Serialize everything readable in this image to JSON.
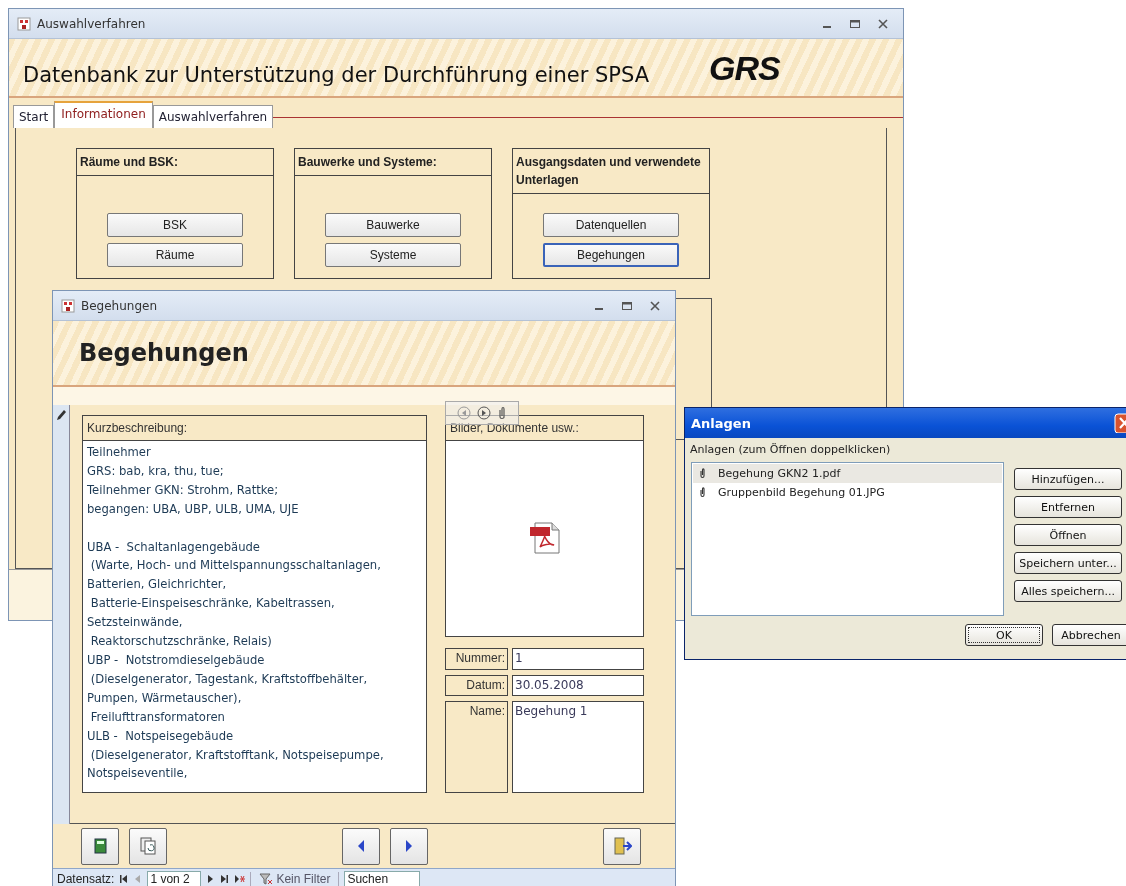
{
  "main_window": {
    "title": "Auswahlverfahren",
    "header_title": "Datenbank zur Unterstützung der Durchführung einer SPSA",
    "logo_text": "GRS",
    "tabs": [
      {
        "label": "Start",
        "selected": false
      },
      {
        "label": "Informationen",
        "selected": true
      },
      {
        "label": "Auswahlverfahren",
        "selected": false
      }
    ],
    "groups": [
      {
        "title": "Räume und BSK:",
        "buttons": [
          {
            "label": "BSK",
            "focused": false
          },
          {
            "label": "Räume",
            "focused": false
          }
        ]
      },
      {
        "title": "Bauwerke und Systeme:",
        "buttons": [
          {
            "label": "Bauwerke",
            "focused": false
          },
          {
            "label": "Systeme",
            "focused": false
          }
        ]
      },
      {
        "title": "Ausgangsdaten und verwendete Unterlagen",
        "buttons": [
          {
            "label": "Datenquellen",
            "focused": false
          },
          {
            "label": "Begehungen",
            "focused": true
          }
        ]
      }
    ]
  },
  "form_window": {
    "title": "Begehungen",
    "header_title": "Begehungen",
    "description": {
      "label": "Kurzbeschreibung:",
      "text": "Teilnehmer\nGRS: bab, kra, thu, tue;\nTeilnehmer GKN: Strohm, Rattke;\nbegangen: UBA, UBP, ULB, UMA, UJE\n\nUBA -  Schaltanlagengebäude\n (Warte, Hoch- und Mittelspannungsschaltanlagen,\nBatterien, Gleichrichter,\n Batterie-Einspeiseschränke, Kabeltrassen,\nSetzsteinwände,\n Reaktorschutzschränke, Relais)\nUBP -  Notstromdieselgebäude\n (Dieselgenerator, Tagestank, Kraftstoffbehälter,\nPumpen, Wärmetauscher),\n Freilufttransformatoren\nULB -  Notspeisegebäude\n (Dieselgenerator, Kraftstofftank, Notspeisepumpe,\nNotspeiseventile,"
    },
    "attachments": {
      "label": "Bilder, Dokumente usw.:"
    },
    "fields": [
      {
        "label": "Nummer:",
        "value": "1",
        "kind": "single"
      },
      {
        "label": "Datum:",
        "value": "30.05.2008",
        "kind": "single"
      },
      {
        "label": "Name:",
        "value": "Begehung 1",
        "kind": "multi"
      }
    ],
    "navigation": {
      "record_label": "Datensatz:",
      "position": "1 von 2",
      "filter": "Kein Filter",
      "search_placeholder": "Suchen"
    }
  },
  "dialog": {
    "title": "Anlagen",
    "hint": "Anlagen (zum Öffnen doppelklicken)",
    "files": [
      {
        "name": "Begehung GKN2 1.pdf",
        "selected": true
      },
      {
        "name": "Gruppenbild Begehung 01.JPG",
        "selected": false
      }
    ],
    "side_buttons": [
      "Hinzufügen...",
      "Entfernen",
      "Öffnen",
      "Speichern unter...",
      "Alles speichern..."
    ],
    "buttons": [
      {
        "label": "OK",
        "default": true
      },
      {
        "label": "Abbrechen",
        "default": false
      }
    ]
  }
}
